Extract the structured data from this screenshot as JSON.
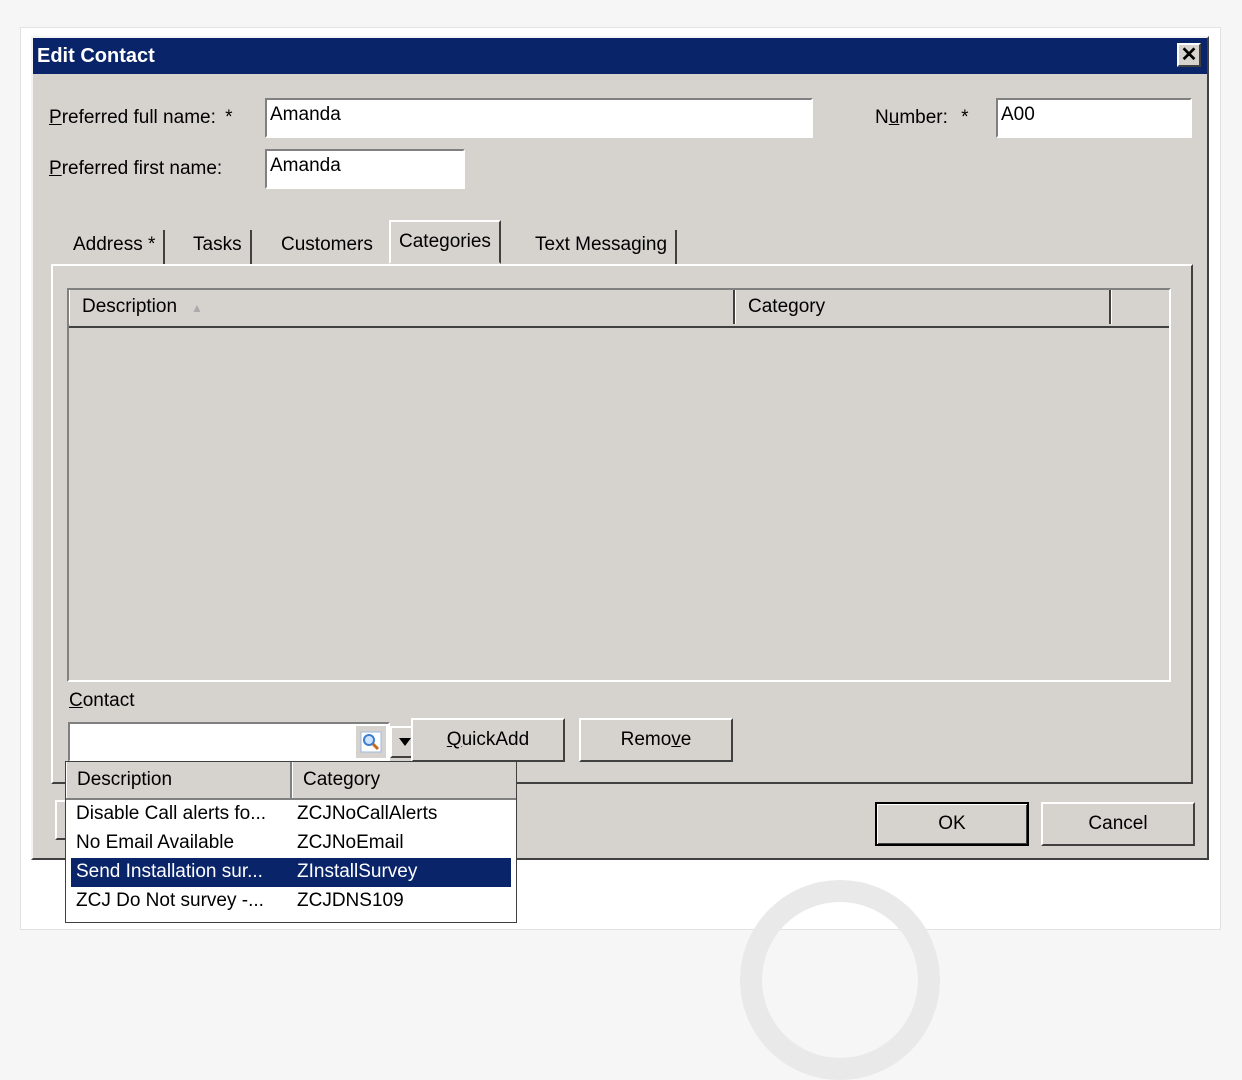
{
  "window": {
    "title": "Edit Contact",
    "close_glyph": "✕"
  },
  "form": {
    "full_name_label_ul": "P",
    "full_name_label_rest": "referred full name:",
    "required_mark": "*",
    "full_name_value": "Amanda",
    "first_name_label_ul": "P",
    "first_name_label_rest": "referred first name:",
    "first_name_value": "Amanda",
    "number_label_pre": "N",
    "number_label_ul": "u",
    "number_label_rest": "mber:",
    "number_value": "A00"
  },
  "tabs": [
    {
      "label": "Address *"
    },
    {
      "label": "Tasks"
    },
    {
      "label": "Customers"
    },
    {
      "label": "Categories",
      "active": true
    },
    {
      "label": "Text Messaging"
    }
  ],
  "list": {
    "columns": [
      "Description",
      "Category"
    ],
    "sort_glyph": "▲"
  },
  "contact": {
    "label_ul": "C",
    "label_rest": "ontact",
    "value": ""
  },
  "buttons": {
    "quickadd_ul": "Q",
    "quickadd_rest": "uickAdd",
    "remove_pre": "Remo",
    "remove_ul": "v",
    "remove_rest": "e",
    "ok": "OK",
    "cancel": "Cancel"
  },
  "popup": {
    "columns": [
      "Description",
      "Category"
    ],
    "rows": [
      {
        "description": "Disable Call alerts fo...",
        "category": "ZCJNoCallAlerts"
      },
      {
        "description": "No Email Available",
        "category": "ZCJNoEmail"
      },
      {
        "description": "Send Installation sur...",
        "category": "ZInstallSurvey",
        "selected": true
      },
      {
        "description": "ZCJ Do Not survey -...",
        "category": "ZCJDNS109"
      }
    ]
  },
  "colors": {
    "titlebar": "#0a246a",
    "dialog_bg": "#d6d3ce",
    "selection": "#0a246a",
    "search_icon": "#3a7fd0"
  },
  "icons": {
    "search": "search-icon",
    "dropdown": "chevron-down-icon",
    "close": "close-icon"
  }
}
